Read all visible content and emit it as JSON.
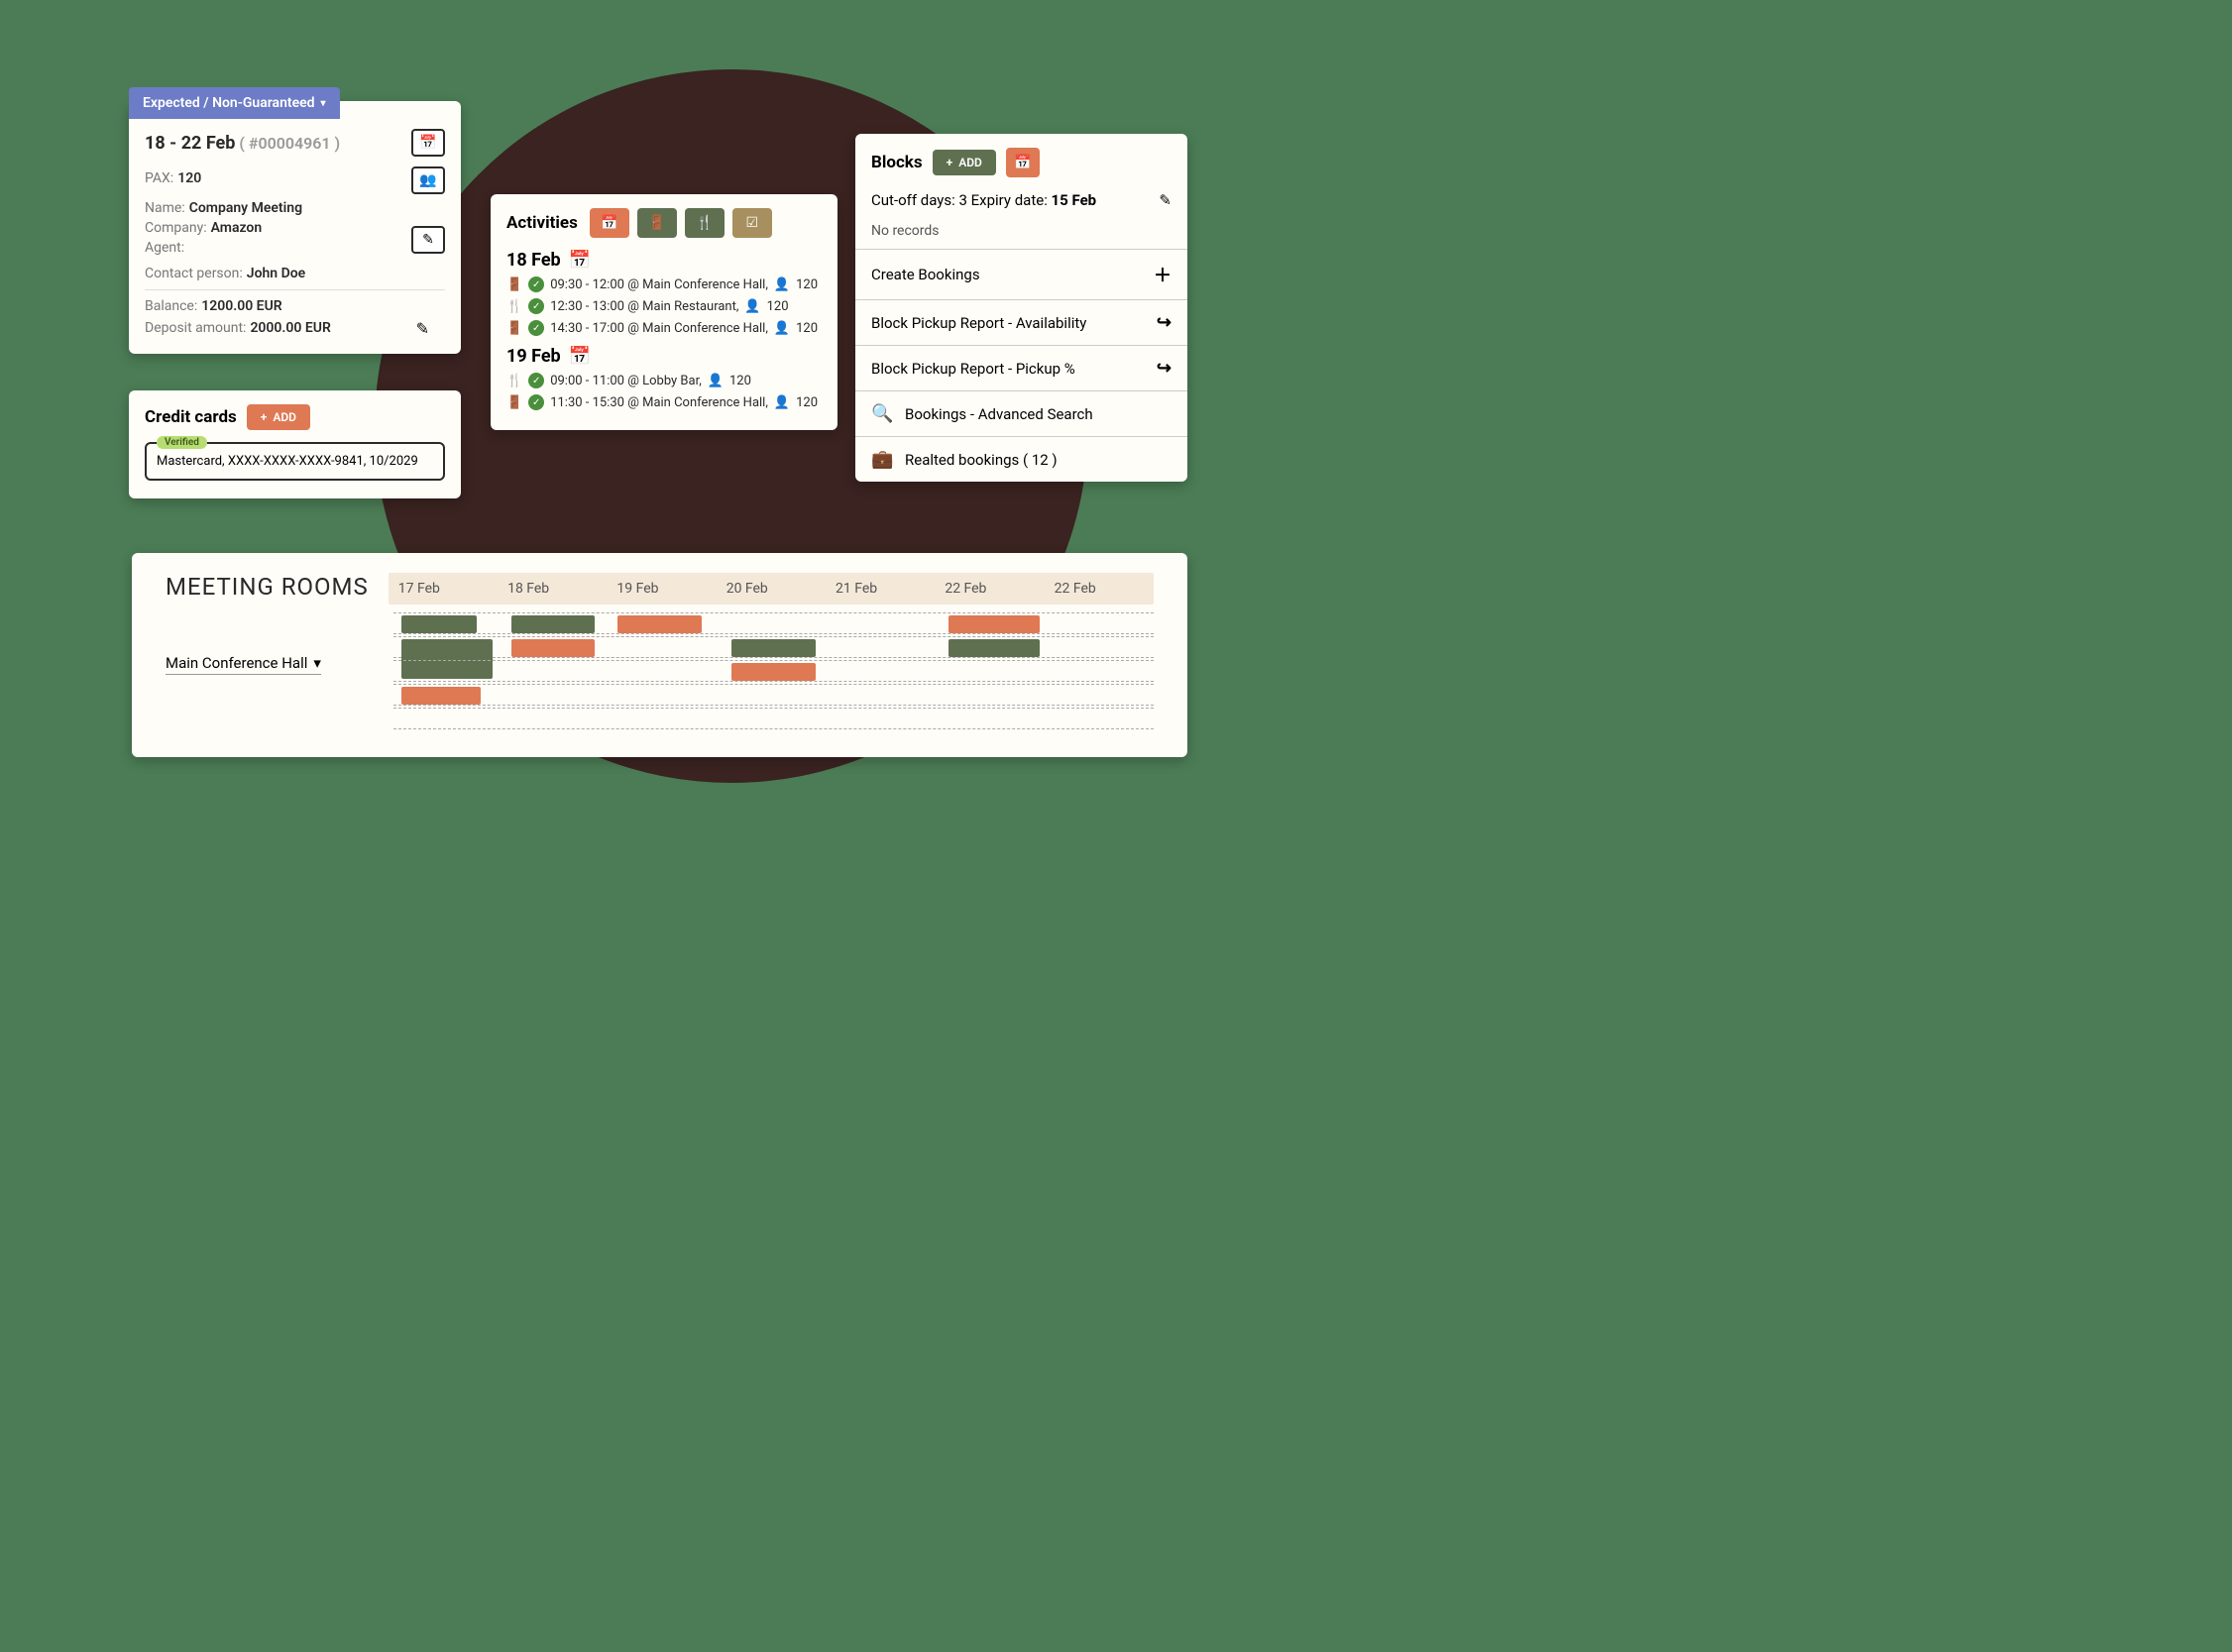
{
  "booking": {
    "status": "Expected / Non-Guaranteed",
    "dates": "18 - 22 Feb",
    "ref": "( #00004961 )",
    "pax_label": "PAX:",
    "pax": "120",
    "name_label": "Name:",
    "name": "Company Meeting",
    "company_label": "Company:",
    "company": "Amazon",
    "agent_label": "Agent:",
    "agent": "",
    "contact_label": "Contact person:",
    "contact": "John Doe",
    "balance_label": "Balance:",
    "balance": "1200.00 EUR",
    "deposit_label": "Deposit amount:",
    "deposit": "2000.00 EUR"
  },
  "credit": {
    "title": "Credit cards",
    "add": "ADD",
    "verified": "Verified",
    "card_text": "Mastercard, XXXX-XXXX-XXXX-9841, 10/2029"
  },
  "activities": {
    "title": "Activities",
    "dates": [
      {
        "label": "18 Feb",
        "items": [
          {
            "icon": "door",
            "text": "09:30 - 12:00 @ Main Conference Hall,",
            "pax": "120"
          },
          {
            "icon": "food",
            "text": "12:30 - 13:00 @ Main Restaurant,",
            "pax": "120"
          },
          {
            "icon": "door",
            "text": "14:30 - 17:00 @ Main Conference Hall,",
            "pax": "120"
          }
        ]
      },
      {
        "label": "19 Feb",
        "items": [
          {
            "icon": "food",
            "text": "09:00 - 11:00 @ Lobby Bar,",
            "pax": "120"
          },
          {
            "icon": "door",
            "text": "11:30 - 15:30 @ Main Conference Hall,",
            "pax": "120"
          }
        ]
      }
    ]
  },
  "blocks": {
    "title": "Blocks",
    "add": "ADD",
    "cutoff_pre": "Cut-off days: 3 Expiry date: ",
    "cutoff_date": "15 Feb",
    "norec": "No records",
    "items": [
      {
        "label": "Create Bookings",
        "icon": "plus"
      },
      {
        "label": "Block Pickup Report - Availability",
        "icon": "arrow"
      },
      {
        "label": "Block Pickup Report - Pickup %",
        "icon": "arrow"
      },
      {
        "label": "Bookings - Advanced Search",
        "icon": "search",
        "leading": true
      },
      {
        "label": "Realted bookings ( 12 )",
        "icon": "briefcase",
        "leading": true
      }
    ]
  },
  "meeting": {
    "title": "MEETING ROOMS",
    "room": "Main Conference Hall",
    "days": [
      "17 Feb",
      "18 Feb",
      "19 Feb",
      "20 Feb",
      "21 Feb",
      "22 Feb",
      "22 Feb"
    ]
  }
}
